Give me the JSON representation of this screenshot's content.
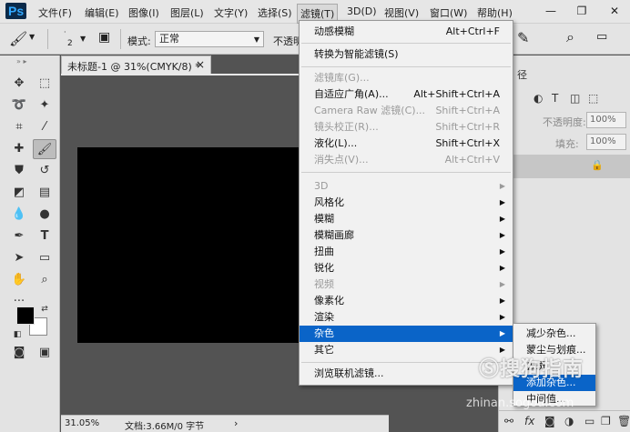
{
  "app": {
    "logo": "Ps"
  },
  "menubar": {
    "items": [
      {
        "label": "文件(F)"
      },
      {
        "label": "编辑(E)"
      },
      {
        "label": "图像(I)"
      },
      {
        "label": "图层(L)"
      },
      {
        "label": "文字(Y)"
      },
      {
        "label": "选择(S)"
      },
      {
        "label": "滤镜(T)"
      },
      {
        "label": "3D(D)"
      },
      {
        "label": "视图(V)"
      },
      {
        "label": "窗口(W)"
      },
      {
        "label": "帮助(H)"
      }
    ],
    "window_controls": {
      "minimize": "—",
      "restore": "❐",
      "close": "✕"
    }
  },
  "options_bar": {
    "brush_size": "2",
    "mode_label": "模式:",
    "mode_value": "正常",
    "opacity_label": "不透明"
  },
  "document": {
    "tab_title": "未标题-1 @ 31%(CMYK/8) *",
    "tab_close": "×",
    "zoom": "31.05%",
    "doc_info": "文档:3.66M/0 字节",
    "status_arrow": "›"
  },
  "filter_menu": {
    "items": [
      {
        "label": "动感模糊",
        "shortcut": "Alt+Ctrl+F",
        "enabled": true
      },
      {
        "label": "转换为智能滤镜(S)",
        "shortcut": "",
        "enabled": true
      },
      {
        "label": "滤镜库(G)...",
        "shortcut": "",
        "enabled": false
      },
      {
        "label": "自适应广角(A)...",
        "shortcut": "Alt+Shift+Ctrl+A",
        "enabled": true
      },
      {
        "label": "Camera Raw 滤镜(C)...",
        "shortcut": "Shift+Ctrl+A",
        "enabled": false
      },
      {
        "label": "镜头校正(R)...",
        "shortcut": "Shift+Ctrl+R",
        "enabled": false
      },
      {
        "label": "液化(L)...",
        "shortcut": "Shift+Ctrl+X",
        "enabled": true
      },
      {
        "label": "消失点(V)...",
        "shortcut": "Alt+Ctrl+V",
        "enabled": false
      },
      {
        "label": "3D",
        "submenu": true,
        "enabled": false
      },
      {
        "label": "风格化",
        "submenu": true,
        "enabled": true
      },
      {
        "label": "模糊",
        "submenu": true,
        "enabled": true
      },
      {
        "label": "模糊画廊",
        "submenu": true,
        "enabled": true
      },
      {
        "label": "扭曲",
        "submenu": true,
        "enabled": true
      },
      {
        "label": "锐化",
        "submenu": true,
        "enabled": true
      },
      {
        "label": "视频",
        "submenu": true,
        "enabled": false
      },
      {
        "label": "像素化",
        "submenu": true,
        "enabled": true
      },
      {
        "label": "渲染",
        "submenu": true,
        "enabled": true
      },
      {
        "label": "杂色",
        "submenu": true,
        "enabled": true,
        "highlighted": true
      },
      {
        "label": "其它",
        "submenu": true,
        "enabled": true
      },
      {
        "label": "浏览联机滤镜...",
        "shortcut": "",
        "enabled": true
      }
    ],
    "arrow": "▶"
  },
  "noise_submenu": {
    "items": [
      {
        "label": "减少杂色..."
      },
      {
        "label": "蒙尘与划痕..."
      },
      {
        "label": "去斑"
      },
      {
        "label": "添加杂色...",
        "highlighted": true
      },
      {
        "label": "中间值..."
      }
    ]
  },
  "right_panel": {
    "tab_label": "径",
    "opacity_label": "不透明度:",
    "opacity_value": "100%",
    "fill_label": "填充:",
    "fill_value": "100%",
    "lock_icon": "🔒"
  },
  "watermark": {
    "main": "搜狗指南",
    "sub": "zhinan.sogou.com"
  },
  "colors": {
    "highlight": "#0a64c8",
    "canvas": "#000000",
    "workspace": "#535353"
  }
}
